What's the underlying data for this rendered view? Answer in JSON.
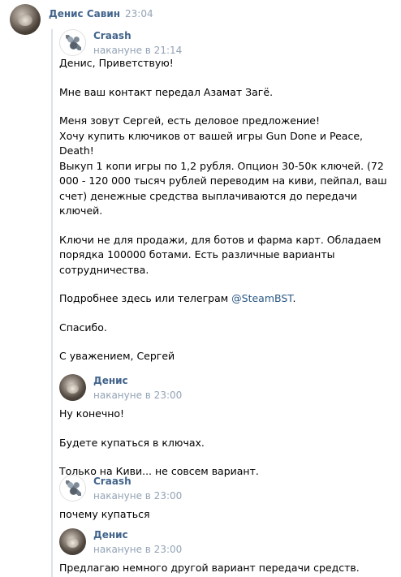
{
  "header": {
    "author": "Денис Савин",
    "time": "23:04"
  },
  "messages": [
    {
      "author": "Craash",
      "time": "накануне в 21:14",
      "lines": {
        "l1": "Денис, Приветствую!",
        "l2": "Мне ваш контакт передал Азамат Загё.",
        "l3": "Меня зовут Сергей, есть деловое предложение!",
        "l4": "Хочу купить ключиков от вашей игры Gun Done и Peace,",
        "l5": "Death!",
        "l6": "Выкуп 1 копи игры по 1,2 рубля. Опцион 30-50к ключей. (72",
        "l7": "000 - 120 000 тысяч рублей переводим на киви, пейпал, ваш",
        "l8": "счет) денежные средства выплачиваются до передачи",
        "l9": "ключей.",
        "l10": "Ключи не для продажи, для ботов и фарма карт. Обладаем",
        "l11": "порядка 100000 ботами. Есть различные варианты",
        "l12": "сотрудничества.",
        "l13": "Подробнее здесь или телеграм ",
        "l13_link": "@SteamBST",
        "l13_end": ".",
        "l14": "Спасибо.",
        "l15": "С уважением, Сергей"
      }
    },
    {
      "author": "Денис",
      "time": "накануне в 23:00",
      "lines": {
        "l1": "Ну конечно!",
        "l2": "Будете купаться в ключах.",
        "l3": "Только на Киви... не совсем вариант."
      }
    },
    {
      "author": "Craash",
      "time": "накануне в 23:00",
      "lines": {
        "l1": "почему купаться"
      }
    },
    {
      "author": "Денис",
      "time": "накануне в 23:00",
      "lines": {
        "l1": "Предлагаю немного другой вариант передачи средств."
      }
    }
  ]
}
